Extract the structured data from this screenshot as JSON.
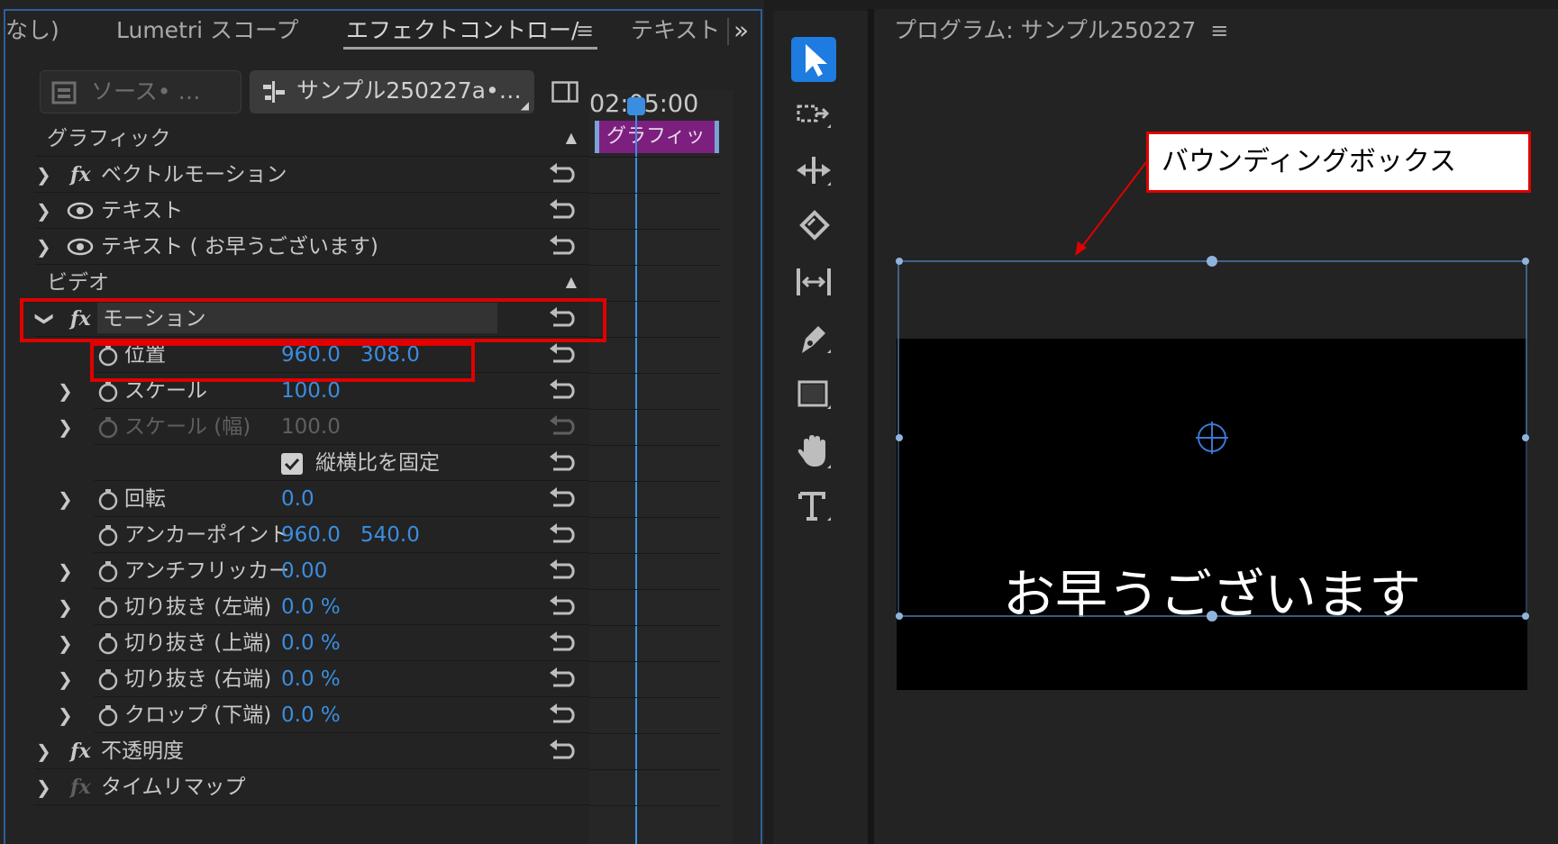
{
  "colors": {
    "accent_blue": "#3b8de0",
    "highlight_red": "#e00000",
    "clip_purple": "#7c1f7e",
    "panel_bg": "#232323"
  },
  "tabs": {
    "none": "なし)",
    "lumetri": "Lumetri スコープ",
    "effect_controls": "エフェクトコントロー/",
    "text": "テキスト",
    "menu_icon": "≡",
    "overflow": "»"
  },
  "source": {
    "source_label": "ソース• …",
    "clip_label": "サンプル250227a•…"
  },
  "timeline": {
    "timecode": "02:05:00",
    "clip_label": "グラフィッ"
  },
  "effects": {
    "graphic_section": "グラフィック",
    "vector_motion": "ベクトルモーション",
    "text1": "テキスト",
    "text2": "テキスト ( お早うございます)",
    "video_section": "ビデオ",
    "motion": "モーション",
    "position": {
      "label": "位置",
      "x": "960.0",
      "y": "308.0"
    },
    "scale": {
      "label": "スケール",
      "value": "100.0"
    },
    "scale_width": {
      "label": "スケール (幅)",
      "value": "100.0"
    },
    "uniform_scale": "縦横比を固定",
    "rotation": {
      "label": "回転",
      "value": "0.0"
    },
    "anchor_point": {
      "label": "アンカーポイント",
      "x": "960.0",
      "y": "540.0"
    },
    "anti_flicker": {
      "label": "アンチフリッカー",
      "value": "0.00"
    },
    "crop_left": {
      "label": "切り抜き (左端)",
      "value": "0.0 %"
    },
    "crop_top": {
      "label": "切り抜き (上端)",
      "value": "0.0 %"
    },
    "crop_right": {
      "label": "切り抜き (右端)",
      "value": "0.0 %"
    },
    "crop_bottom": {
      "label": "クロップ (下端)",
      "value": "0.0 %"
    },
    "opacity": "不透明度",
    "time_remap": "タイムリマップ"
  },
  "tools": [
    "selection-tool",
    "track-select-tool",
    "ripple-edit-tool",
    "razor-tool",
    "slip-tool",
    "pen-tool",
    "rectangle-tool",
    "hand-tool",
    "type-tool"
  ],
  "program": {
    "title": "プログラム: サンプル250227",
    "menu_icon": "≡",
    "caption": "お早うございます"
  },
  "annotation": {
    "callout": "バウンディングボックス"
  }
}
